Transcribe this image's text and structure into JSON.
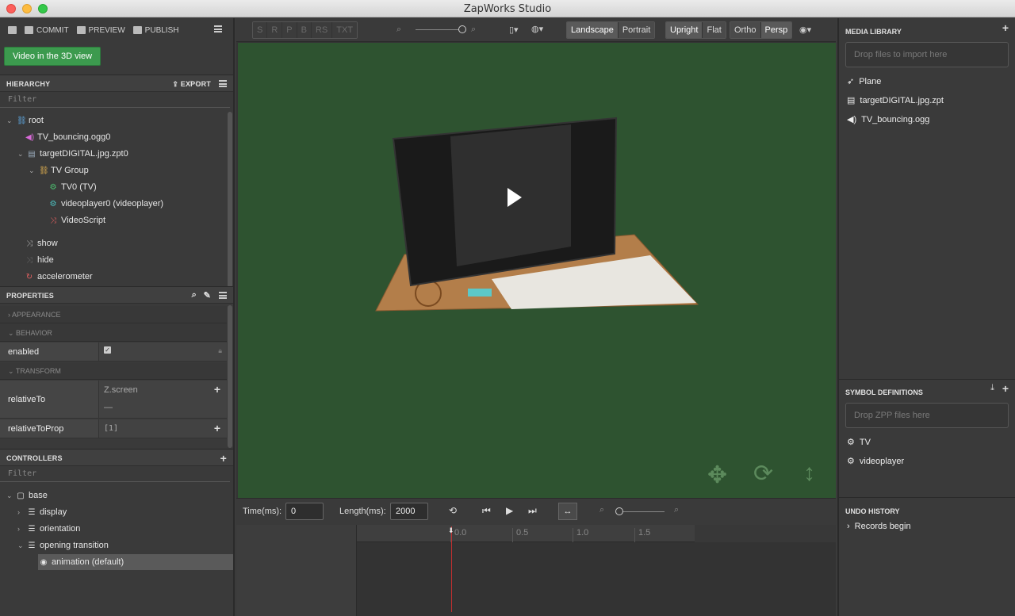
{
  "window": {
    "title": "ZapWorks Studio"
  },
  "left_toolbar": {
    "commit": "COMMIT",
    "preview": "PREVIEW",
    "publish": "PUBLISH"
  },
  "video_button": "Video in the 3D view",
  "hierarchy": {
    "title": "HIERARCHY",
    "export": "EXPORT",
    "filter_placeholder": "Filter",
    "items": [
      {
        "label": "root"
      },
      {
        "label": "TV_bouncing.ogg0"
      },
      {
        "label": "targetDIGITAL.jpg.zpt0"
      },
      {
        "label": "TV Group"
      },
      {
        "label": "TV0 (TV)"
      },
      {
        "label": "videoplayer0 (videoplayer)"
      },
      {
        "label": "VideoScript"
      },
      {
        "label": "show"
      },
      {
        "label": "hide"
      },
      {
        "label": "accelerometer"
      }
    ]
  },
  "properties": {
    "title": "PROPERTIES",
    "sections": {
      "appearance": "APPEARANCE",
      "behavior": "BEHAVIOR",
      "transform": "TRANSFORM"
    },
    "enabled_label": "enabled",
    "relativeTo_label": "relativeTo",
    "relativeTo_value": "Z.screen",
    "relativeTo_sub": "—",
    "relativeToProp_label": "relativeToProp",
    "relativeToProp_value": "[1]"
  },
  "controllers": {
    "title": "CONTROLLERS",
    "filter_placeholder": "Filter",
    "items": [
      {
        "label": "base"
      },
      {
        "label": "display"
      },
      {
        "label": "orientation"
      },
      {
        "label": "opening transition"
      },
      {
        "label": "animation (default)"
      }
    ]
  },
  "top_toolbar": {
    "modes": [
      "S",
      "R",
      "P",
      "B",
      "RS",
      "TXT"
    ],
    "orientation": [
      "Landscape",
      "Portrait"
    ],
    "upright": [
      "Upright",
      "Flat"
    ],
    "projection": [
      "Ortho",
      "Persp"
    ]
  },
  "timeline": {
    "time_label": "Time(ms):",
    "time_value": "0",
    "length_label": "Length(ms):",
    "length_value": "2000",
    "ticks": [
      "0.0",
      "0.5",
      "1.0",
      "1.5"
    ]
  },
  "media_library": {
    "title": "MEDIA LIBRARY",
    "drop_text": "Drop files to import here",
    "items": [
      {
        "label": "Plane",
        "icon": "rocket-icon"
      },
      {
        "label": "targetDIGITAL.jpg.zpt",
        "icon": "file-icon"
      },
      {
        "label": "TV_bouncing.ogg",
        "icon": "speaker-icon"
      }
    ]
  },
  "symbol_definitions": {
    "title": "SYMBOL DEFINITIONS",
    "drop_text": "Drop ZPP files here",
    "items": [
      {
        "label": "TV"
      },
      {
        "label": "videoplayer"
      }
    ]
  },
  "undo_history": {
    "title": "UNDO HISTORY",
    "items": [
      {
        "label": "Records begin"
      }
    ]
  },
  "colors": {
    "viewport": "#2e5330",
    "accent_green": "#3c9a4e"
  }
}
